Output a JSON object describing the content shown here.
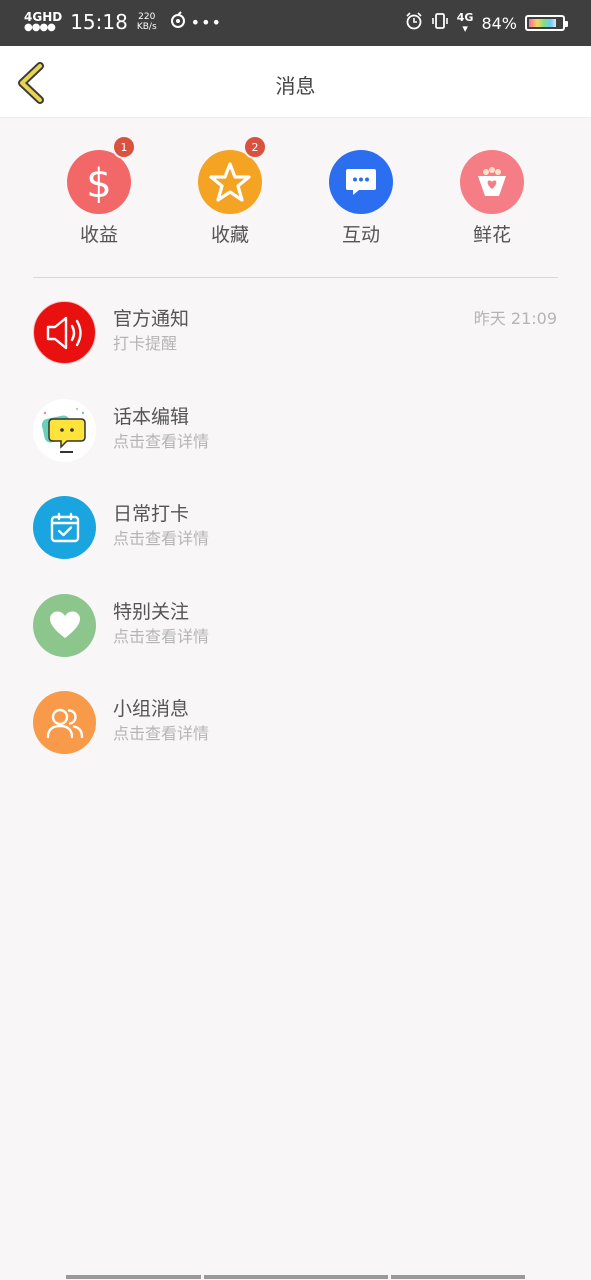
{
  "status_bar": {
    "network": "4GHD",
    "signal_dots": "●●●●",
    "time": "15:18",
    "speed_value": "220",
    "speed_unit": "KB/s",
    "app_icon": "netease-music-icon",
    "more": "•••",
    "net_type": "4G",
    "battery_percent": "84%"
  },
  "header": {
    "title": "消息"
  },
  "quick_actions": [
    {
      "label": "收益",
      "badge": "1",
      "color": "#f26868",
      "icon": "dollar-icon"
    },
    {
      "label": "收藏",
      "badge": "2",
      "color": "#f5a323",
      "icon": "star-icon"
    },
    {
      "label": "互动",
      "badge": "",
      "color": "#2b6ef0",
      "icon": "chat-bubble-icon"
    },
    {
      "label": "鲜花",
      "badge": "",
      "color": "#f57e86",
      "icon": "flower-bouquet-icon"
    }
  ],
  "messages": [
    {
      "title": "官方通知",
      "subtitle": "打卡提醒",
      "time": "昨天 21:09",
      "color": "#e91010",
      "icon": "speaker-icon"
    },
    {
      "title": "话本编辑",
      "subtitle": "点击查看详情",
      "time": "",
      "color": "#ffffff",
      "icon": "editor-avatar-icon"
    },
    {
      "title": "日常打卡",
      "subtitle": "点击查看详情",
      "time": "",
      "color": "#1aa5e0",
      "icon": "calendar-check-icon"
    },
    {
      "title": "特别关注",
      "subtitle": "点击查看详情",
      "time": "",
      "color": "#8cc68d",
      "icon": "heart-icon"
    },
    {
      "title": "小组消息",
      "subtitle": "点击查看详情",
      "time": "",
      "color": "#f89a4a",
      "icon": "group-users-icon"
    }
  ],
  "colors": {
    "accent_back": "#e8d44d",
    "badge": "#d9513f"
  }
}
